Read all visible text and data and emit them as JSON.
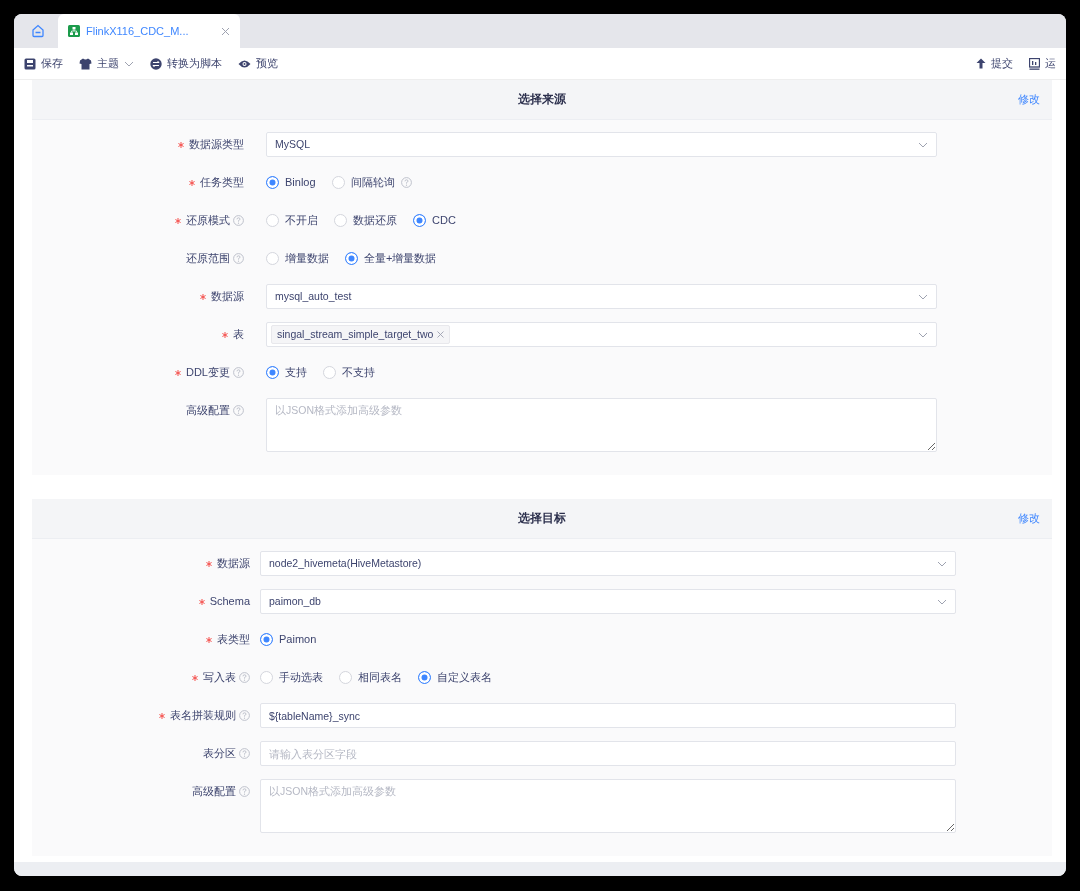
{
  "tabs": [
    {
      "kind": "home",
      "selected": false
    },
    {
      "kind": "task",
      "label": "FlinkX116_CDC_M...",
      "selected": true
    }
  ],
  "toolbar": {
    "left": [
      {
        "label": "保存",
        "dropdown": false
      },
      {
        "label": "主题",
        "dropdown": true
      },
      {
        "label": "转换为脚本",
        "dropdown": false
      },
      {
        "label": "预览",
        "dropdown": false
      }
    ],
    "right": [
      {
        "label": "提交"
      },
      {
        "label": "运"
      }
    ]
  },
  "sections": [
    {
      "title": "选择来源",
      "action": "修改",
      "fields": [
        {
          "label": "数据源类型",
          "required": true,
          "help": false,
          "kind": "select",
          "value": "MySQL"
        },
        {
          "label": "任务类型",
          "required": true,
          "help": false,
          "kind": "radio",
          "options": [
            {
              "label": "Binlog",
              "selected": true,
              "help": false
            },
            {
              "label": "间隔轮询",
              "selected": false,
              "help": true
            }
          ]
        },
        {
          "label": "还原模式",
          "required": true,
          "help": true,
          "kind": "radio",
          "options": [
            {
              "label": "不开启",
              "selected": false,
              "help": false
            },
            {
              "label": "数据还原",
              "selected": false,
              "help": false
            },
            {
              "label": "CDC",
              "selected": true,
              "help": false
            }
          ]
        },
        {
          "label": "还原范围",
          "required": false,
          "help": true,
          "kind": "radio",
          "options": [
            {
              "label": "增量数据",
              "selected": false,
              "help": false
            },
            {
              "label": "全量+增量数据",
              "selected": true,
              "help": false
            }
          ]
        },
        {
          "label": "数据源",
          "required": true,
          "help": false,
          "kind": "select",
          "value": "mysql_auto_test"
        },
        {
          "label": "表",
          "required": true,
          "help": false,
          "kind": "tags",
          "tags": [
            "singal_stream_simple_target_two"
          ]
        },
        {
          "label": "DDL变更",
          "required": true,
          "help": true,
          "kind": "radio",
          "options": [
            {
              "label": "支持",
              "selected": true,
              "help": false
            },
            {
              "label": "不支持",
              "selected": false,
              "help": false
            }
          ]
        },
        {
          "label": "高级配置",
          "required": false,
          "help": true,
          "kind": "textarea",
          "placeholder": "以JSON格式添加高级参数"
        }
      ]
    },
    {
      "title": "选择目标",
      "action": "修改",
      "fields": [
        {
          "label": "数据源",
          "required": true,
          "help": false,
          "kind": "select",
          "value": "node2_hivemeta(HiveMetastore)"
        },
        {
          "label": "Schema",
          "required": true,
          "help": false,
          "kind": "select",
          "value": "paimon_db"
        },
        {
          "label": "表类型",
          "required": true,
          "help": false,
          "kind": "radio",
          "options": [
            {
              "label": "Paimon",
              "selected": true,
              "help": false
            }
          ]
        },
        {
          "label": "写入表",
          "required": true,
          "help": true,
          "kind": "radio",
          "options": [
            {
              "label": "手动选表",
              "selected": false,
              "help": false
            },
            {
              "label": "相同表名",
              "selected": false,
              "help": false
            },
            {
              "label": "自定义表名",
              "selected": true,
              "help": false
            }
          ]
        },
        {
          "label": "表名拼装规则",
          "required": true,
          "help": true,
          "kind": "input",
          "value": "${tableName}_sync"
        },
        {
          "label": "表分区",
          "required": false,
          "help": true,
          "kind": "input",
          "placeholder": "请输入表分区字段"
        },
        {
          "label": "高级配置",
          "required": false,
          "help": true,
          "kind": "textarea",
          "placeholder": "以JSON格式添加高级参数"
        }
      ]
    }
  ]
}
